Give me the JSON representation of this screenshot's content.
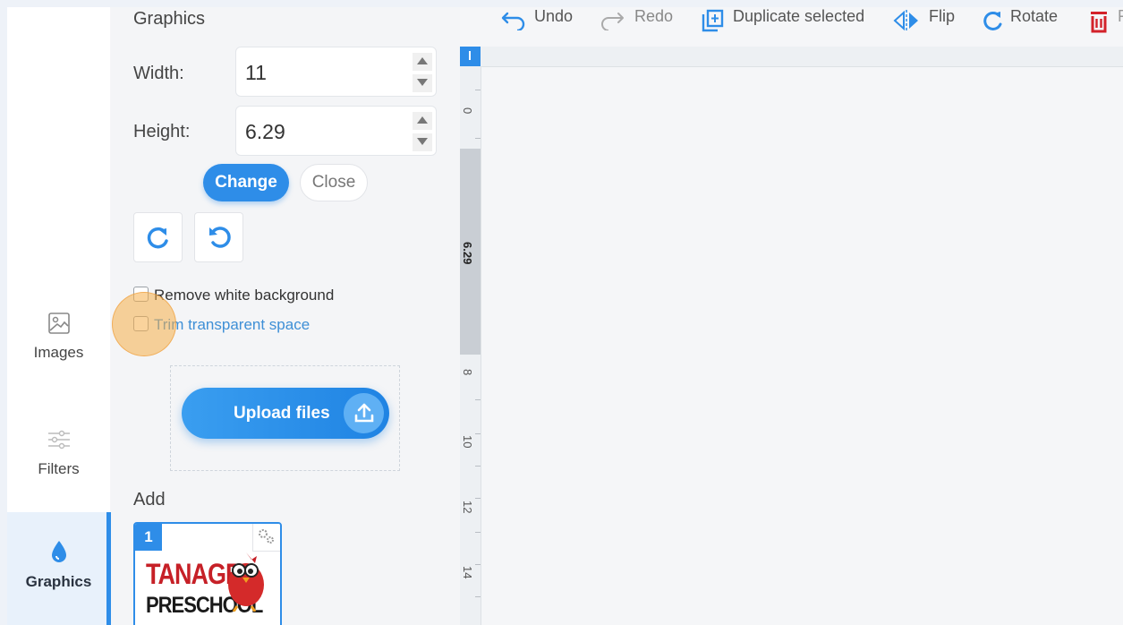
{
  "rail": {
    "items": [
      {
        "label": "Images",
        "icon": "image-icon"
      },
      {
        "label": "Filters",
        "icon": "sliders-icon"
      },
      {
        "label": "Graphics",
        "icon": "drop-icon",
        "active": true
      }
    ]
  },
  "panel": {
    "title": "Graphics",
    "width_label": "Width:",
    "width_value": "11",
    "height_label": "Height:",
    "height_value": "6.29",
    "change_label": "Change",
    "close_label": "Close",
    "remove_white_bg": "Remove white background",
    "trim_transparent": "Trim transparent space",
    "upload_label": "Upload files",
    "add_label": "Add",
    "thumb": {
      "number": "1",
      "line1": "TANAGER",
      "line2": "PRESCHOOL"
    }
  },
  "toolbar": {
    "undo": "Undo",
    "redo": "Redo",
    "duplicate": "Duplicate selected",
    "flip": "Flip",
    "rotate": "Rotate",
    "delete_partial": "F"
  },
  "ruler": {
    "labels": [
      "0",
      "6.29",
      "8",
      "10",
      "12",
      "14"
    ]
  },
  "colors": {
    "accent": "#2e8de8",
    "highlight": "#f6ae4a",
    "logo_red": "#c62027"
  }
}
